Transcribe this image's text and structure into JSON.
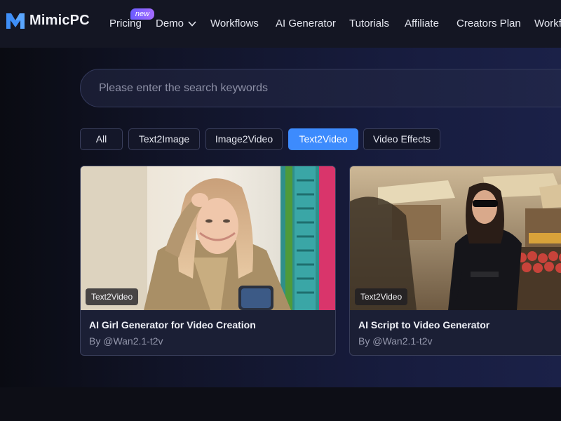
{
  "header": {
    "logo_text": "MimicPC",
    "nav": [
      {
        "label": "Pricing"
      },
      {
        "label": "Demo"
      },
      {
        "label": "Workflows"
      },
      {
        "label": "AI Generator"
      },
      {
        "label": "Tutorials"
      },
      {
        "label": "Affiliate"
      },
      {
        "label": "Creators Plan"
      },
      {
        "label": "Workf"
      }
    ],
    "pricing_badge": "new"
  },
  "search": {
    "placeholder": "Please enter the search keywords",
    "value": ""
  },
  "filters": [
    {
      "label": "All",
      "active": false
    },
    {
      "label": "Text2Image",
      "active": false
    },
    {
      "label": "Image2Video",
      "active": false
    },
    {
      "label": "Text2Video",
      "active": true
    },
    {
      "label": "Video Effects",
      "active": false
    }
  ],
  "cards": [
    {
      "tag": "Text2Video",
      "title": "AI Girl Generator for Video Creation",
      "author": "By @Wan2.1-t2v"
    },
    {
      "tag": "Text2Video",
      "title": "AI Script to Video Generator",
      "author": "By @Wan2.1-t2v"
    }
  ],
  "colors": {
    "accent": "#3d8bfd",
    "badge_gradient_start": "#6b5cff",
    "badge_gradient_end": "#a46bff"
  }
}
